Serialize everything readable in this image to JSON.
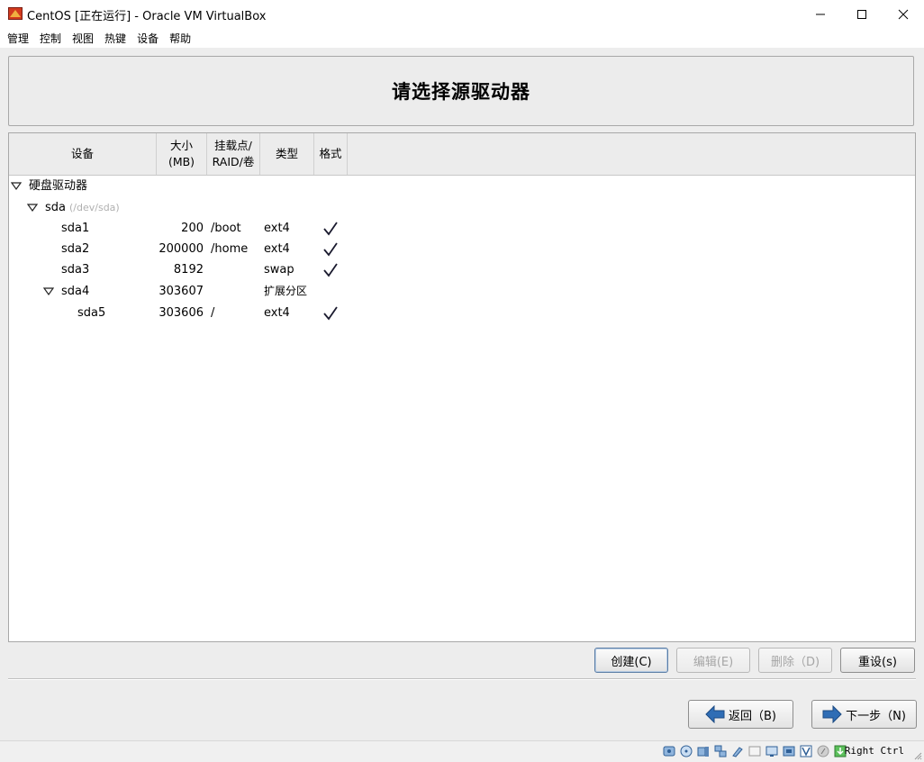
{
  "window": {
    "title": "CentOS [正在运行] - Oracle VM VirtualBox",
    "minimize_label": "–",
    "maximize_label": "□",
    "close_label": "×"
  },
  "menubar": {
    "items": [
      "管理",
      "控制",
      "视图",
      "热键",
      "设备",
      "帮助"
    ]
  },
  "installer": {
    "page_title": "请选择源驱动器",
    "columns": {
      "device": "设备",
      "size_line1": "大小",
      "size_line2": "(MB)",
      "mount_line1": "挂载点/",
      "mount_line2": "RAID/卷",
      "type": "类型",
      "format": "格式"
    },
    "tree": {
      "group_label": "硬盘驱动器",
      "disk_name": "sda",
      "disk_path": "(/dev/sda)",
      "partitions": [
        {
          "name": "sda1",
          "size": "200",
          "mount": "/boot",
          "type": "ext4",
          "format": true
        },
        {
          "name": "sda2",
          "size": "200000",
          "mount": "/home",
          "type": "ext4",
          "format": true
        },
        {
          "name": "sda3",
          "size": "8192",
          "mount": "",
          "type": "swap",
          "format": true
        },
        {
          "name": "sda4",
          "size": "303607",
          "mount": "",
          "type": "扩展分区",
          "format": false
        },
        {
          "name": "sda5",
          "size": "303606",
          "mount": "/",
          "type": "ext4",
          "format": true
        }
      ]
    },
    "buttons": {
      "create": "创建(C)",
      "edit": "编辑(E)",
      "delete": "删除（D)",
      "reset": "重设(s)",
      "back": "返回（B)",
      "next": "下一步（N)"
    }
  },
  "statusbar": {
    "host_key": "Right Ctrl"
  },
  "colors": {
    "guest_bg": "#ededed",
    "arrow_blue": "#2f6db5",
    "check_color": "#1a1a2e"
  }
}
